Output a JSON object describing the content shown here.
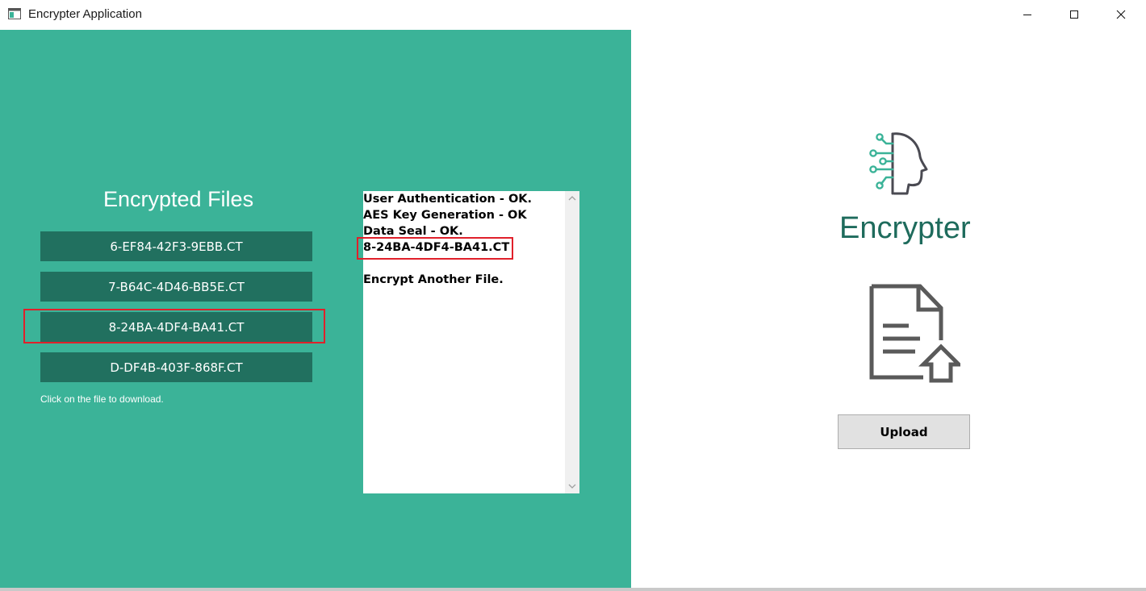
{
  "window": {
    "title": "Encrypter Application"
  },
  "files_panel": {
    "title": "Encrypted Files",
    "files": [
      "6-EF84-42F3-9EBB.CT",
      "7-B64C-4D46-BB5E.CT",
      "8-24BA-4DF4-BA41.CT",
      "D-DF4B-403F-868F.CT"
    ],
    "hint": "Click on the file to download."
  },
  "log": {
    "lines": [
      "User Authentication - OK.",
      "AES Key Generation - OK",
      "Data Seal - OK.",
      "8-24BA-4DF4-BA41.CT",
      "",
      "Encrypt Another File."
    ]
  },
  "brand": {
    "name": "Encrypter"
  },
  "upload": {
    "label": "Upload"
  },
  "colors": {
    "panel_green": "#3bb398",
    "file_button": "#21705f",
    "brand_text": "#1e6b5c",
    "highlight": "#e0202a"
  },
  "icons": {
    "app": "app-window-icon",
    "brand": "head-circuit-icon",
    "document": "document-upload-icon"
  }
}
